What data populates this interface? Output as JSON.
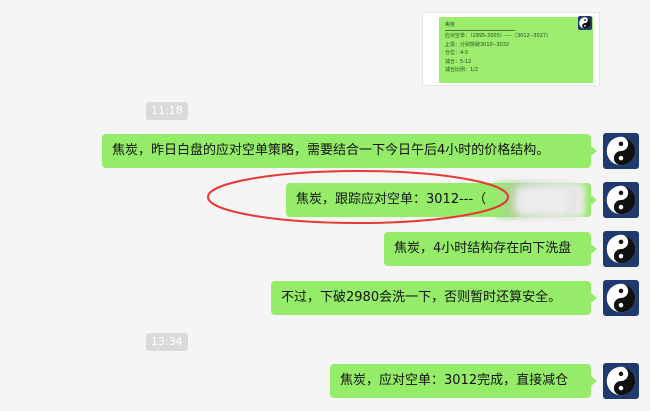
{
  "chat": {
    "image_card": {
      "lines": [
        "焦炭",
        "应对空单：（2995-3005）----（3012--3027）",
        "止损：分别突破3010--3032",
        "仓位：4-5",
        "减仓：5-12",
        "减仓比例：1/2"
      ]
    },
    "timestamps": [
      "11:18",
      "13:34"
    ],
    "messages": [
      "焦炭，昨日白盘的应对空单策略，需要结合一下今日午后4小时的价格结构。",
      "焦炭，跟踪应对空单：3012---（",
      "焦炭，4小时结构存在向下洗盘",
      "不过，下破2980会洗一下，否则暂时还算安全。",
      "焦炭，应对空单：3012完成，直接减仓"
    ],
    "colors": {
      "bubble": "#95ec69",
      "avatar_bg": "#1f3a6e",
      "highlight": "#e53935",
      "timestamp_bg": "#dadada"
    },
    "icons": {
      "avatar": "yin-yang-icon"
    }
  }
}
